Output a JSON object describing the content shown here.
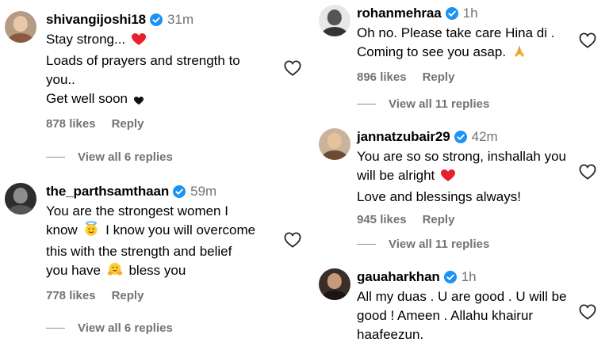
{
  "left": {
    "comments": [
      {
        "username": "shivangijoshi18",
        "time": "31m",
        "lines": [
          "Stay strong... ",
          "Loads of prayers and strength to",
          "you..",
          "Get well soon "
        ],
        "likes": "878 likes",
        "reply": "Reply",
        "view_replies": "View all 6 replies"
      },
      {
        "username": "the_parthsamthaan",
        "time": "59m",
        "lines": [
          "You are the strongest women I",
          "know ",
          " I know you will overcome",
          "this with the strength and belief",
          "you have ",
          " bless you"
        ],
        "likes": "778 likes",
        "reply": "Reply",
        "view_replies": "View all 6 replies"
      }
    ]
  },
  "right": {
    "comments": [
      {
        "username": "rohanmehraa",
        "time": "1h",
        "lines": [
          "Oh no. Please take care Hina di .",
          "Coming to see you asap. "
        ],
        "likes": "896 likes",
        "reply": "Reply",
        "view_replies": "View all 11 replies"
      },
      {
        "username": "jannatzubair29",
        "time": "42m",
        "lines": [
          "You are so so strong, inshallah you",
          "will be alright ",
          "Love and blessings always!"
        ],
        "likes": "945 likes",
        "reply": "Reply",
        "view_replies": "View all 11 replies"
      },
      {
        "username": "gauaharkhan",
        "time": "1h",
        "lines": [
          "All my duas . U are good . U will be",
          "good ! Ameen . Allahu khairur",
          "haafeezun."
        ]
      }
    ]
  },
  "icons": {
    "verified": "verified-badge-icon",
    "like": "heart-outline-icon",
    "red_heart": "red-heart-emoji",
    "black_heart": "black-heart-emoji",
    "halo": "smiling-face-with-halo-emoji",
    "hug": "hugging-face-emoji",
    "pray": "folded-hands-emoji"
  },
  "colors": {
    "verified": "#1a93f5",
    "muted": "#737373",
    "red_heart": "#e8202b"
  }
}
